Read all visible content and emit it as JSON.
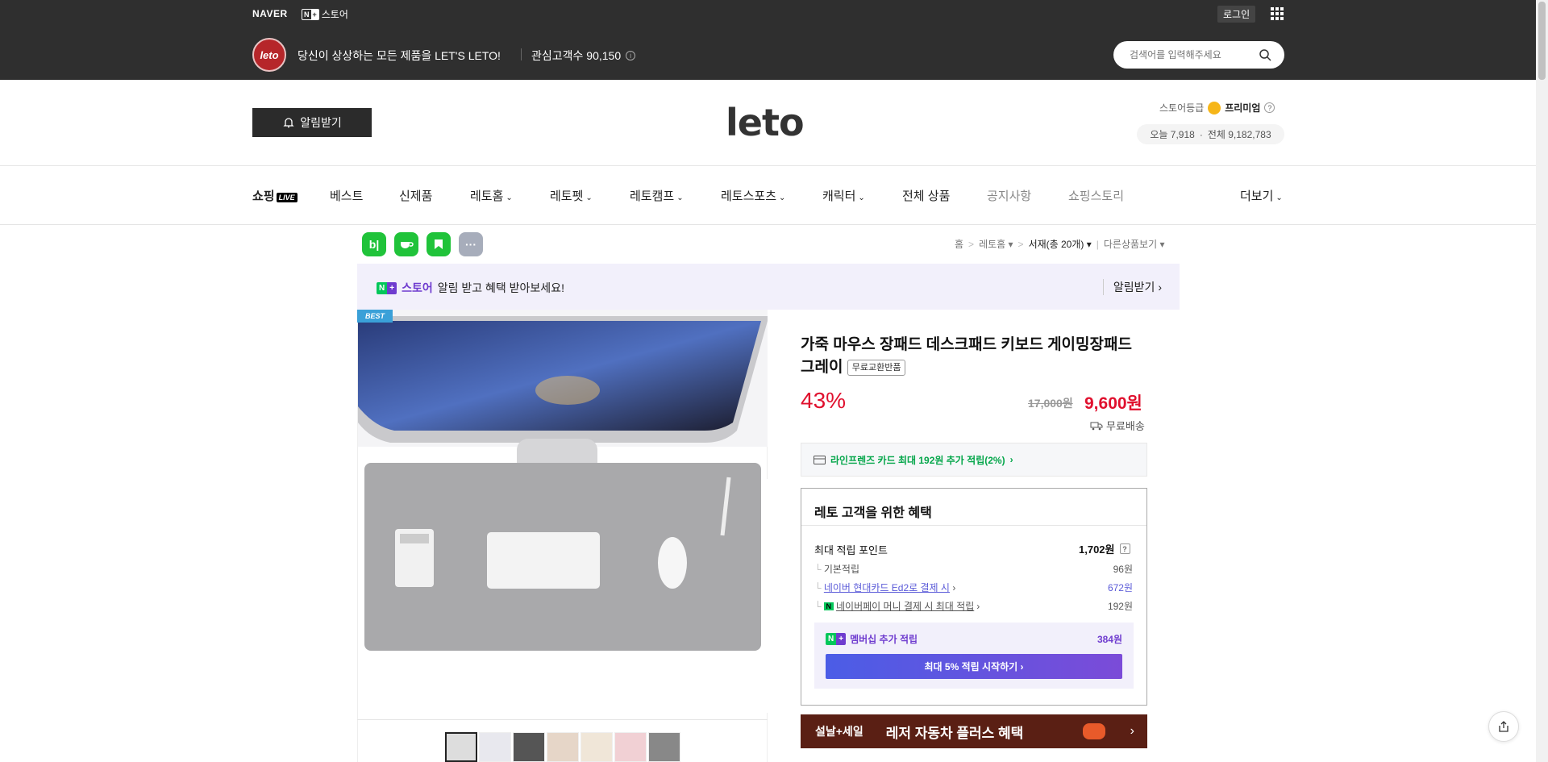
{
  "topbar": {
    "naver": "NAVER",
    "nplus_n": "N",
    "nplus_plus": "+",
    "nplus_store": "스토어",
    "login": "로그인",
    "store_logo_text": "leto",
    "slogan": "당신이 상상하는 모든 제품을 LET'S LETO!",
    "fans_label": "관심고객수 90,150",
    "search_placeholder": "검색어를 입력해주세요",
    "bg_color": "#2f2f2f"
  },
  "header": {
    "alarm_button": "알림받기",
    "brand_logo": "leto",
    "grade_label": "스토어등급",
    "grade_value": "프리미엄",
    "today": "오늘 7,918",
    "dot": "·",
    "total": "전체 9,182,783"
  },
  "nav": {
    "shopping": "쇼핑",
    "live": "LIVE",
    "items": [
      "베스트",
      "신제품",
      "레토홈",
      "레토펫",
      "레토캠프",
      "레토스포츠",
      "캐릭터",
      "전체 상품",
      "공지사항",
      "쇼핑스토리",
      "더보기"
    ]
  },
  "share_icons": [
    "band-icon",
    "talk-icon",
    "bookmark-icon",
    "more-icon"
  ],
  "breadcrumb": {
    "home": "홈",
    "category": "레토홈",
    "sub": "서재(총 20개)",
    "other": "다른상품보기"
  },
  "alert_banner": {
    "store": "스토어",
    "text": "알림 받고 혜택 받아보세요!",
    "action": "알림받기"
  },
  "product": {
    "best_badge": "BEST",
    "title": "가죽 마우스 장패드 데스크패드 키보드 게이밍장패드 그레이",
    "tag": "무료교환반품",
    "discount": "43%",
    "original_price": "17,000원",
    "sale_price": "9,600원",
    "shipping": "무료배송",
    "card_offer": "라인프렌즈 카드 최대 192원 추가 적립(2%)",
    "sale_color": "#e0102e"
  },
  "benefits": {
    "title": "레토 고객을 위한 혜택",
    "max_points_label": "최대 적립 포인트",
    "max_points_value": "1,702원",
    "rows": [
      {
        "label": "기본적립",
        "value": "96원"
      },
      {
        "label": "네이버 현대카드 Ed2로 결제 시",
        "value": "672원"
      },
      {
        "label": "네이버페이 머니 결제 시 최대 적립",
        "value": "192원"
      }
    ],
    "membership_label": "멤버십 추가 적립",
    "membership_value": "384원",
    "membership_button": "최대 5% 적립 시작하기"
  },
  "promo": {
    "left": "설날+세일",
    "main": "레저 자동차 플러스 혜택"
  }
}
